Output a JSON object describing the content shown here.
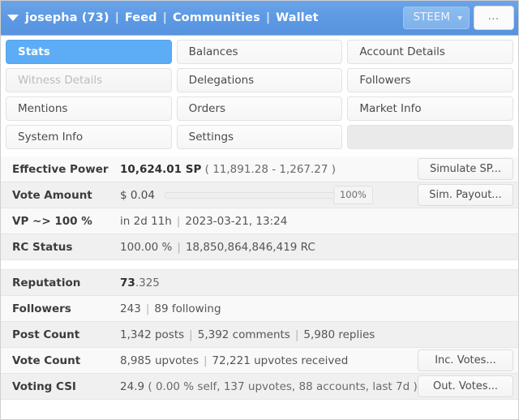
{
  "navbar": {
    "caret_icon": "caret-down-icon",
    "username": "josepha (73)",
    "links": [
      "Feed",
      "Communities",
      "Wallet"
    ],
    "separator": "|",
    "chip_label": "STEEM",
    "chip_caret_icon": "caret-down-small-icon",
    "more_label": "…",
    "accent_color": "#5d99e3"
  },
  "tabs": [
    [
      {
        "label": "Stats",
        "state": "active"
      },
      {
        "label": "Balances",
        "state": "normal"
      },
      {
        "label": "Account Details",
        "state": "normal"
      }
    ],
    [
      {
        "label": "Witness Details",
        "state": "disabled"
      },
      {
        "label": "Delegations",
        "state": "normal"
      },
      {
        "label": "Followers",
        "state": "normal"
      }
    ],
    [
      {
        "label": "Mentions",
        "state": "normal"
      },
      {
        "label": "Orders",
        "state": "normal"
      },
      {
        "label": "Market Info",
        "state": "normal"
      }
    ],
    [
      {
        "label": "System Info",
        "state": "normal"
      },
      {
        "label": "Settings",
        "state": "normal"
      },
      {
        "label": "",
        "state": "empty"
      }
    ]
  ],
  "active_tab": "Stats",
  "stats_group_1": [
    {
      "label": "Effective Power",
      "value_strong": "10,624.01 SP",
      "value_muted": " ( 11,891.28 - 1,267.27 )",
      "action": "Simulate SP..."
    },
    {
      "label": "Vote Amount",
      "amount": "$ 0.04",
      "slider_value": "100%",
      "slider_percent": 100,
      "action": "Sim. Payout..."
    },
    {
      "label": "VP ~> 100 %",
      "parts": [
        "in 2d 11h",
        "2023-03-21, 13:24"
      ],
      "action": ""
    },
    {
      "label": "RC Status",
      "parts": [
        "100.00 %",
        "18,850,864,846,419 RC"
      ],
      "action": ""
    }
  ],
  "stats_group_2": [
    {
      "label": "Reputation",
      "value_strong": "73",
      "value_muted": ".325",
      "action": ""
    },
    {
      "label": "Followers",
      "parts": [
        "243",
        "89 following"
      ],
      "action": ""
    },
    {
      "label": "Post Count",
      "parts": [
        "1,342 posts",
        "5,392 comments",
        "5,980 replies"
      ],
      "action": ""
    },
    {
      "label": "Vote Count",
      "parts": [
        "8,985 upvotes",
        "72,221 upvotes received"
      ],
      "action": "Inc. Votes..."
    },
    {
      "label": "Voting CSI",
      "value_strong": "24.9",
      "value_muted": " ( 0.00 % self, 137 upvotes, 88 accounts, last 7d )",
      "action": "Out. Votes..."
    }
  ]
}
